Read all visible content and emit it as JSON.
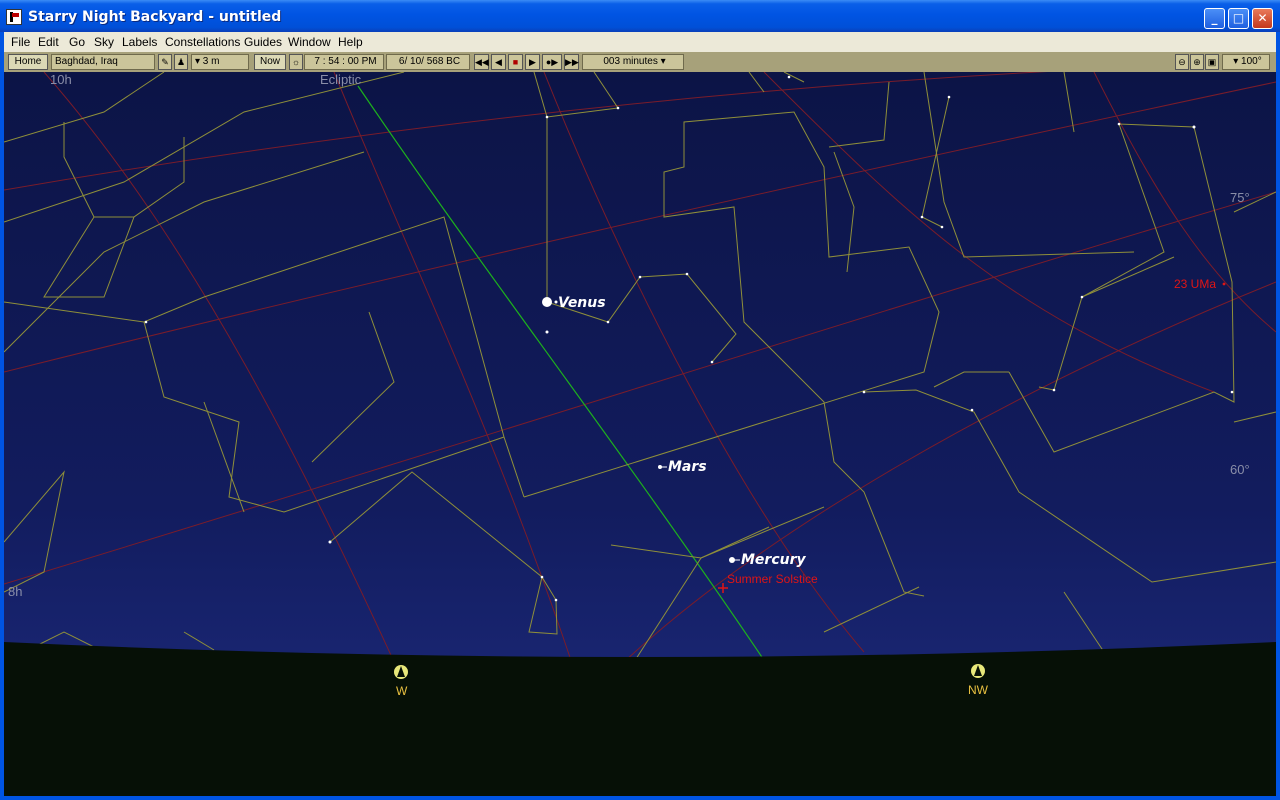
{
  "window": {
    "title": "Starry Night Backyard - untitled",
    "minimize": "_",
    "maximize": "□",
    "close": "✕"
  },
  "menu": [
    "File",
    "Edit",
    "Go",
    "Sky",
    "Labels",
    "Constellations",
    "Guides",
    "Window",
    "Help"
  ],
  "toolbar": {
    "home": "Home",
    "location": "Baghdad, Iraq",
    "elevation": "▾ 3 m",
    "now": "Now",
    "time": "7 : 54 : 00 PM",
    "date": "6/ 10/   568 BC",
    "time_step": "003 minutes ▾",
    "fov": "▾ 100°"
  },
  "sky": {
    "labels": {
      "ecliptic": "Ecliptic",
      "ra_10h": "10h",
      "ra_8h": "8h",
      "alt_75": "75°",
      "alt_60": "60°",
      "star_23uma": "23 UMa"
    },
    "planets": [
      {
        "name": "Venus"
      },
      {
        "name": "Mars"
      },
      {
        "name": "Mercury"
      }
    ],
    "events": {
      "solstice": "Summer Solstice"
    },
    "compass": {
      "w": "W",
      "nw": "NW"
    },
    "colors": {
      "sky_top": "#0c1446",
      "sky_bottom": "#1c2a7c",
      "ground": "#061006",
      "constellation": "#8f8f3a",
      "ecliptic": "#1db11d",
      "grid": "#7a1c2a",
      "label_red": "#e01515"
    }
  }
}
